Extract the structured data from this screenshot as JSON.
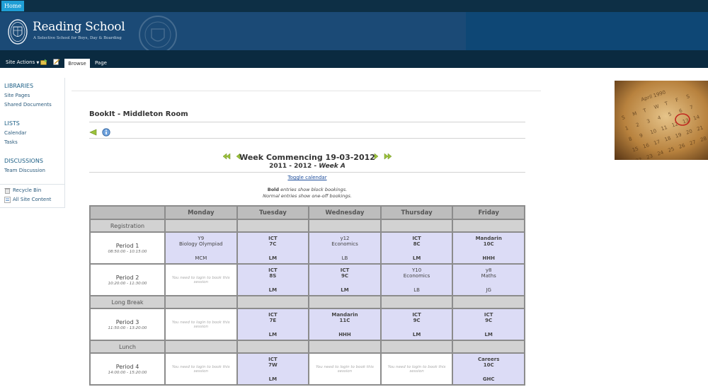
{
  "topbar": {
    "home_label": "Home"
  },
  "banner": {
    "title": "Reading School",
    "subtitle": "A Selective School for Boys, Day & Boarding"
  },
  "ribbon": {
    "site_actions": "Site Actions",
    "tabs": [
      {
        "label": "Browse"
      },
      {
        "label": "Page"
      }
    ]
  },
  "leftnav": {
    "sections": [
      {
        "heading": "LIBRARIES",
        "items": [
          "Site Pages",
          "Shared Documents"
        ]
      },
      {
        "heading": "LISTS",
        "items": [
          "Calendar",
          "Tasks"
        ]
      },
      {
        "heading": "DISCUSSIONS",
        "items": [
          "Team Discussion"
        ]
      }
    ],
    "footer": [
      "Recycle Bin",
      "All Site Content"
    ]
  },
  "page": {
    "title": "BookIt - Middleton Room",
    "week": "Week Commencing 19-03-2012",
    "year": "2011 - 2012 - ",
    "week_label": "Week A",
    "toggle": "Toggle calendar",
    "legend_bold": "Bold",
    "legend_bold_rest": " entries show block bookings.",
    "legend_normal": "Normal entries show one-off bookings."
  },
  "timetable": {
    "days": [
      "Monday",
      "Tuesday",
      "Wednesday",
      "Thursday",
      "Friday"
    ],
    "login_text": "You need to login to book this session",
    "rows": [
      {
        "type": "sep",
        "label": "Registration"
      },
      {
        "type": "period",
        "name": "Period 1",
        "time": "08:50:00 - 10:15:00",
        "cells": [
          {
            "kind": "normal",
            "l1": "Y9",
            "l2": "Biology Olympiad",
            "l3": "MCM"
          },
          {
            "kind": "bold",
            "l1": "ICT",
            "l2": "7C",
            "l3": "LM"
          },
          {
            "kind": "normal",
            "l1": "y12",
            "l2": "Economics",
            "l3": "LB"
          },
          {
            "kind": "bold",
            "l1": "ICT",
            "l2": "8C",
            "l3": "LM"
          },
          {
            "kind": "bold",
            "l1": "Mandarin",
            "l2": "10C",
            "l3": "HHH"
          }
        ]
      },
      {
        "type": "period",
        "name": "Period 2",
        "time": "10:20:00 - 11:30:00",
        "cells": [
          {
            "kind": "empty"
          },
          {
            "kind": "bold",
            "l1": "ICT",
            "l2": "8S",
            "l3": "LM"
          },
          {
            "kind": "bold",
            "l1": "ICT",
            "l2": "9C",
            "l3": "LM"
          },
          {
            "kind": "normal",
            "l1": "Y10",
            "l2": "Economics",
            "l3": "LB"
          },
          {
            "kind": "normal",
            "l1": "y8",
            "l2": "Maths",
            "l3": "JG"
          }
        ]
      },
      {
        "type": "sep",
        "label": "Long Break"
      },
      {
        "type": "period",
        "name": "Period 3",
        "time": "11:50:00 - 13:20:00",
        "cells": [
          {
            "kind": "empty"
          },
          {
            "kind": "bold",
            "l1": "ICT",
            "l2": "7E",
            "l3": "LM"
          },
          {
            "kind": "bold",
            "l1": "Mandarin",
            "l2": "11C",
            "l3": "HHH"
          },
          {
            "kind": "bold",
            "l1": "ICT",
            "l2": "9C",
            "l3": "LM"
          },
          {
            "kind": "bold",
            "l1": "ICT",
            "l2": "9C",
            "l3": "LM"
          }
        ]
      },
      {
        "type": "sep",
        "label": "Lunch"
      },
      {
        "type": "period",
        "name": "Period 4",
        "time": "14:00:00 - 15:20:00",
        "cells": [
          {
            "kind": "empty"
          },
          {
            "kind": "bold",
            "l1": "ICT",
            "l2": "7W",
            "l3": "LM"
          },
          {
            "kind": "empty"
          },
          {
            "kind": "empty"
          },
          {
            "kind": "bold",
            "l1": "Careers",
            "l2": "10C",
            "l3": "GHC"
          }
        ]
      }
    ]
  }
}
